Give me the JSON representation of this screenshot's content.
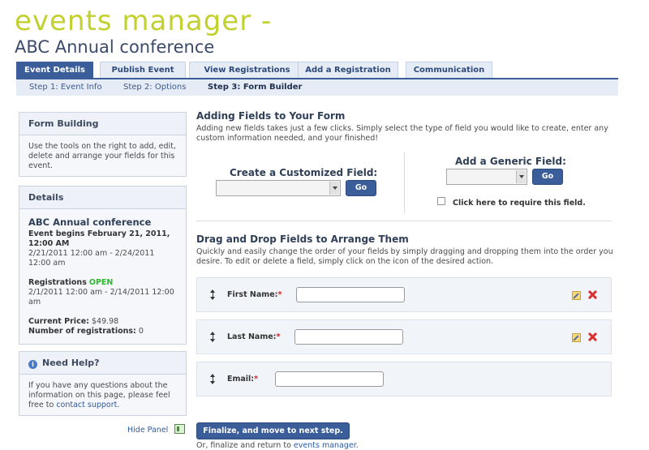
{
  "header": {
    "app_title": "events manager -",
    "event_name": "ABC Annual conference"
  },
  "tabs": [
    {
      "label": "Event Details",
      "active": true
    },
    {
      "label": "Publish Event",
      "active": false
    },
    {
      "label": "View Registrations",
      "active": false
    },
    {
      "label": "Add a Registration",
      "active": false
    },
    {
      "label": "Communication",
      "active": false
    }
  ],
  "steps": [
    {
      "label": "Step 1: Event Info",
      "active": false
    },
    {
      "label": "Step 2: Options",
      "active": false
    },
    {
      "label": "Step 3: Form Builder",
      "active": true
    }
  ],
  "sidebar": {
    "form_building": {
      "title": "Form Building",
      "text": "Use the tools on the right to add, edit, delete and arrange your fields for this event."
    },
    "details": {
      "title": "Details",
      "event_title": "ABC Annual conference",
      "event_begins": "Event begins February 21, 2011, 12:00 AM",
      "event_range": "2/21/2011 12:00 am - 2/24/2011 12:00 am",
      "registrations_label": "Registrations",
      "registrations_status": "OPEN",
      "registration_range": "2/1/2011 12:00 am - 2/14/2011 12:00 am",
      "current_price_label": "Current Price:",
      "current_price": "$49.98",
      "num_registrations_label": "Number of registrations:",
      "num_registrations": "0"
    },
    "help": {
      "title": "Need Help?",
      "text": "If you have any questions about the information on this page, please feel free to",
      "link": "contact support",
      "text_end": "."
    },
    "hide_panel": "Hide Panel"
  },
  "main": {
    "adding_title": "Adding Fields to Your Form",
    "adding_desc": "Adding new fields takes just a few clicks. Simply select the type of field you would like to create, enter any custom information needed, and your finished!",
    "custom_field_title": "Create a Customized Field:",
    "generic_field_title": "Add a Generic Field:",
    "go_label": "Go",
    "require_label": "Click here to require this field.",
    "drag_title": "Drag and Drop Fields to Arrange Them",
    "drag_desc": "Quickly and easily change the order of your fields by simply dragging and dropping them into the order you desire. To edit or delete a field, simply click on the icon of the desired action.",
    "fields": [
      {
        "label": "First Name:",
        "required": "*"
      },
      {
        "label": "Last Name:",
        "required": "*"
      },
      {
        "label": "Email:",
        "required": "*"
      }
    ],
    "finalize_label": "Finalize, and move to next step.",
    "return_text": "Or, finalize and return to",
    "return_link": "events manager",
    "return_end": "."
  }
}
